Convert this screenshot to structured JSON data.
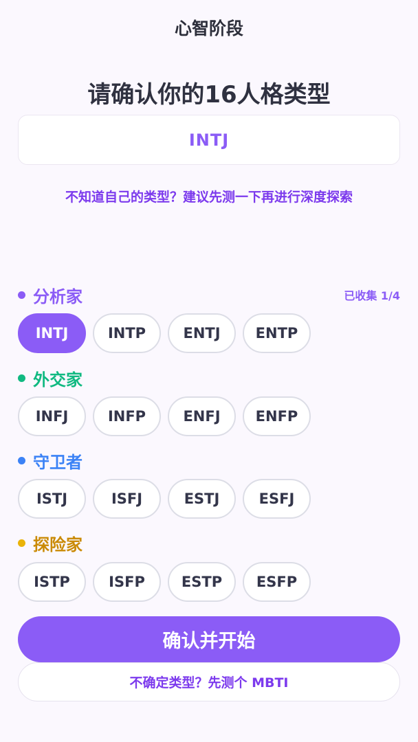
{
  "nav": {
    "title": "心智阶段"
  },
  "heading": "请确认你的16人格类型",
  "selected_type": "INTJ",
  "hint": "不知道自己的类型？建议先测一下再进行深度探索",
  "groups": [
    {
      "label": "分析家",
      "color": "#8b5cf6",
      "collected": "已收集 1/4",
      "types": [
        "INTJ",
        "INTP",
        "ENTJ",
        "ENTP"
      ],
      "active_index": 0
    },
    {
      "label": "外交家",
      "color": "#10b981",
      "types": [
        "INFJ",
        "INFP",
        "ENFJ",
        "ENFP"
      ]
    },
    {
      "label": "守卫者",
      "color": "#3b82f6",
      "types": [
        "ISTJ",
        "ISFJ",
        "ESTJ",
        "ESFJ"
      ]
    },
    {
      "label": "探险家",
      "color": "#ca8a04",
      "types": [
        "ISTP",
        "ISFP",
        "ESTP",
        "ESFP"
      ]
    }
  ],
  "buttons": {
    "confirm": "确认并开始",
    "take_test": "不确定类型？先测个 MBTI"
  },
  "colors": {
    "accent": "#8b5cf6",
    "background": "#fbf8fe"
  }
}
